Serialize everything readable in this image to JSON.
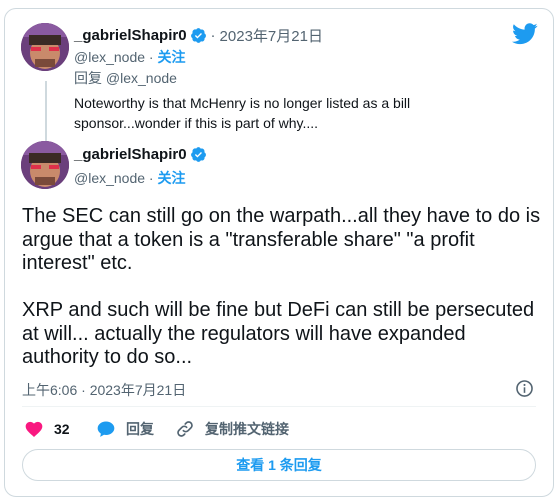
{
  "colors": {
    "accent": "#1d9bf0",
    "like": "#f91880",
    "text_primary": "#0f1419",
    "text_secondary": "#536471",
    "border": "#cfd9de"
  },
  "header": {
    "logo_icon": "twitter-bird-icon"
  },
  "quoted_tweet": {
    "display_name": "_gabrielShapir0",
    "verified_icon": "verified-badge-icon",
    "separator": "·",
    "date": "2023年7月21日",
    "handle": "@lex_node",
    "handle_separator": " · ",
    "follow_label": "关注",
    "reply_prefix": "回复",
    "reply_handle": "@lex_node",
    "text": "Noteworthy is that McHenry is no longer listed as a bill sponsor...wonder if this is part of why...."
  },
  "main_tweet": {
    "display_name": "_gabrielShapir0",
    "verified_icon": "verified-badge-icon",
    "handle": "@lex_node",
    "handle_separator": " · ",
    "follow_label": "关注",
    "text": "The SEC can still go on the warpath...all they have to do is argue that a token is a \"transferable share\" \"a profit interest\" etc.\n\nXRP and such will be fine but DeFi can still be persecuted at will... actually the regulators will have expanded authority to do so...",
    "timestamp": "上午6:06 · 2023年7月21日",
    "info_icon": "info-icon"
  },
  "actions": {
    "likes": "32",
    "like_icon": "heart-icon",
    "reply_label": "回复",
    "reply_icon": "speech-bubble-icon",
    "copy_link_label": "复制推文链接",
    "copy_link_icon": "link-icon"
  },
  "footer": {
    "read_replies_label": "查看 1 条回复"
  }
}
